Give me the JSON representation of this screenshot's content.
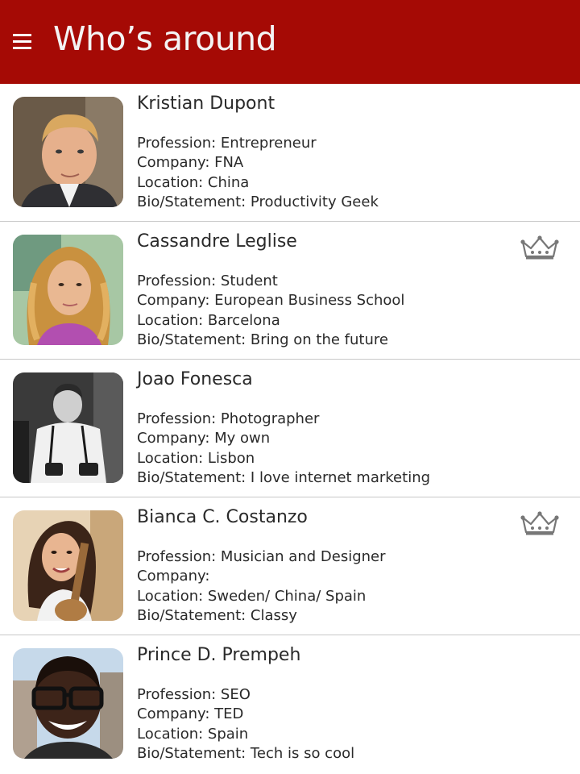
{
  "header": {
    "title": "Who’s around",
    "color": "#a50a05"
  },
  "people": [
    {
      "name": "Kristian Dupont",
      "profession": "Profession: Entrepreneur",
      "company": "Company: FNA",
      "location": "Location: China",
      "bio": "Bio/Statement: Productivity Geek",
      "premium": false
    },
    {
      "name": "Cassandre Leglise",
      "profession": "Profession: Student",
      "company": "Company: European Business School",
      "location": "Location: Barcelona",
      "bio": "Bio/Statement: Bring on the future",
      "premium": true
    },
    {
      "name": "Joao Fonesca",
      "profession": "Profession: Photographer",
      "company": "Company: My own",
      "location": "Location: Lisbon",
      "bio": "Bio/Statement: I love internet marketing",
      "premium": false
    },
    {
      "name": "Bianca C. Costanzo",
      "profession": "Profession: Musician and Designer",
      "company": "Company:",
      "location": "Location: Sweden/ China/ Spain",
      "bio": "Bio/Statement: Classy",
      "premium": true
    },
    {
      "name": "Prince D. Prempeh",
      "profession": "Profession: SEO",
      "company": "Company: TED",
      "location": "Location: Spain",
      "bio": "Bio/Statement: Tech is so cool",
      "premium": false
    }
  ],
  "icons": {
    "menu": "menu-icon",
    "premium": "crown-icon"
  }
}
